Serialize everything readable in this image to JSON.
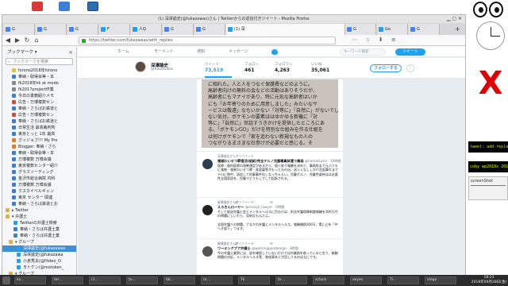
{
  "browser": {
    "window_title": "(1) 深澤諭史(@fukazawas)さん | Twitterからの返信付きツイート - Mozilla Firefox",
    "url": "https://twitter.com/fukazawas/with_replies",
    "tabs": [
      "G",
      "G",
      "G",
      "F",
      "人Q",
      "G",
      "G",
      "(1) 深",
      "G",
      "Go",
      "G"
    ],
    "tab_active_index": 7,
    "nav_buttons": [
      "◀",
      "▶",
      "↻",
      "⌂"
    ],
    "tool_icons": "⋯ ☆ ⬇ ≡"
  },
  "sidebar": {
    "title": "ブックマーク ▾",
    "close": "×",
    "search_placeholder": "ブックマークを検索",
    "items": [
      {
        "label": "hirono2018年hirono",
        "color": "#e8c23a",
        "indent": 12,
        "selected": false
      },
      {
        "label": "奉納・取得会等・本",
        "color": "#3a7ed6",
        "indent": 12,
        "selected": false
      },
      {
        "label": "fk2018年hk at modo",
        "color": "#888888",
        "indent": 12,
        "selected": false
      },
      {
        "label": "fk2017project作業",
        "color": "#888888",
        "indent": 12,
        "selected": false
      },
      {
        "label": "今日の書籍紹介メモ",
        "color": "#3a7ed6",
        "indent": 12,
        "selected": false
      },
      {
        "label": "広告・万博複数セン",
        "color": "#d64a3a",
        "indent": 12,
        "selected": false
      },
      {
        "label": "奉納・さらばお鉄道と",
        "color": "#3a7ed6",
        "indent": 12,
        "selected": false
      },
      {
        "label": "広告・万博複数セン",
        "color": "#d64a3a",
        "indent": 12,
        "selected": false
      },
      {
        "label": "奉納・さらばお鉄道と",
        "color": "#3a7ed6",
        "indent": 12,
        "selected": false
      },
      {
        "label": "日常生活 最高裁判所",
        "color": "#3a7ed6",
        "indent": 12,
        "selected": false
      },
      {
        "label": "東京とっと 1年 最高",
        "color": "#3a7ed6",
        "indent": 12,
        "selected": false
      },
      {
        "label": "グッジョブ!!! My Pro",
        "color": "#e87d1e",
        "indent": 12,
        "selected": false
      },
      {
        "label": "Blogger: 奉納・さら",
        "color": "#e87d1e",
        "indent": 12,
        "selected": false
      },
      {
        "label": "奉納・取得会等・本",
        "color": "#3a7ed6",
        "indent": 12,
        "selected": false
      },
      {
        "label": "万博複数 万博会議",
        "color": "#3a7ed6",
        "indent": 12,
        "selected": false
      },
      {
        "label": "東京複数センター紹介",
        "color": "#3a7ed6",
        "indent": 12,
        "selected": false
      },
      {
        "label": "グラスソーディング",
        "color": "#3a7ed6",
        "indent": 12,
        "selected": false
      },
      {
        "label": "金沢市総合病院 内科",
        "color": "#3a7ed6",
        "indent": 12,
        "selected": false
      },
      {
        "label": "万博複数 万博会議",
        "color": "#3a7ed6",
        "indent": 12,
        "selected": false
      },
      {
        "label": "クスカイベルギャン",
        "color": "#3a7ed6",
        "indent": 12,
        "selected": false
      },
      {
        "label": "東京 センター 関連",
        "color": "#3a7ed6",
        "indent": 12,
        "selected": false
      },
      {
        "label": "奉納・さらば鉄道とお",
        "color": "#3a7ed6",
        "indent": 12,
        "selected": false
      },
      {
        "label": "▸ Twitter",
        "color": "#e0b040",
        "indent": 4,
        "selected": false
      },
      {
        "label": "▾ 弁護士",
        "color": "#e0b040",
        "indent": 4,
        "selected": false
      },
      {
        "label": "Twitterの弁護士検索",
        "color": "#1da1f2",
        "indent": 14,
        "selected": false
      },
      {
        "label": "奉納・さらば弁護士業",
        "color": "#3a7ed6",
        "indent": 14,
        "selected": false
      },
      {
        "label": "奉納・さらば弁護士業",
        "color": "#3a7ed6",
        "indent": 14,
        "selected": false
      },
      {
        "label": "▾ グループ",
        "color": "#e0b040",
        "indent": 8,
        "selected": false
      },
      {
        "label": "深澤諭史(@fukazawas",
        "color": "#1da1f2",
        "indent": 18,
        "selected": true
      },
      {
        "label": "深澤諭史(@fukazawa",
        "color": "#1da1f2",
        "indent": 18,
        "selected": false
      },
      {
        "label": "小倉秀夫(@Hideo_O",
        "color": "#1da1f2",
        "indent": 18,
        "selected": false
      },
      {
        "label": "モトケン(@motoken_",
        "color": "#1da1f2",
        "indent": 18,
        "selected": false
      },
      {
        "label": "▾ グループ",
        "color": "#e0b040",
        "indent": 8,
        "selected": false
      },
      {
        "label": "奉納・新聞・裁判・",
        "color": "#3a7ed6",
        "indent": 18,
        "selected": false
      }
    ]
  },
  "twitter": {
    "nav": [
      "ホーム",
      "モーメント",
      "通知",
      "メッセージ"
    ],
    "search_placeholder": "キーワード検索",
    "tweet_button": "ツイート",
    "profile": {
      "name": "深澤諭史",
      "handle": "@fukazawas",
      "stats": [
        {
          "label": "ツイート",
          "value": "73,519",
          "active": true
        },
        {
          "label": "フォロー",
          "value": "461",
          "active": false
        },
        {
          "label": "フォロワー",
          "value": "4,263",
          "active": false
        },
        {
          "label": "いいね",
          "value": "35,061",
          "active": false
        }
      ],
      "follow_button": "フォローする",
      "more_button": "⋮"
    },
    "photo_text": [
      "に相れた。人と人をつなぐ保護費などのように。",
      "高齢者向けの無料の会などの活動はありそうだが、",
      "高齢者にもマナイがあり、特に元気な高齢者はいか",
      "にも「お年寄りのために用意しました」みたいなサ",
      "ービスは敬遠」なもいかない「対等に」「自然に」がないでし",
      "ない気付。ボケモンの要素ははゆかゆる新機に「対",
      "等に」「自然に」世話すうきかけを提供したところにあ",
      "る。「ボケモンGO」だけを特別な仕組みを作る仕組を",
      "は何けボケモンで「家を追わない新規なもの人の",
      "つながりるまさまな社参けが必要だと感じる。そ"
    ],
    "tweets": [
      {
        "retweet_by": "深澤諭史さんがリツイート",
        "author": "複雑わいせつ罪復活(紹紹)完全テルノ児童職員試運ラ業画",
        "meta": "@hamasiyosi · 16時間",
        "body": "医師・歯科医師の過剰規定があるから、個人依り報酬を決めて、事務所まで元ぶうもに強制・強制わいせつ罪・准容疑等がもっと分の出、送らくなししかけ否起算れまでテロに問中、訴訟して刑事事件化しなっちゃえい。児童ポルノ、児童性虐待はは必要性全国容認を、児童マどうもしでして起訴される。",
        "avatar_color": "#2c3e50"
      },
      {
        "retweet_by": "深澤諭史さんがリツイート",
        "author": "えろきんローヤー",
        "meta": "@erosyo_lawyer · 9時間",
        "body": "そして放送弁護士会とメンタルヘルスに目仕けば、刑法弁護保障制度報酬を300万円の問題にしいたら、深刻なもんだよ。\n\n全国弁護人の問題、ナなかわ弁護とメンタルヘルス、報酬補償300万、実に心を「中へす部下」つます。",
        "avatar_color": "#222222"
      },
      {
        "retweet_by": "深澤諭史さんがリツイート",
        "author": "ワーキングプア弁護士",
        "meta": "@workingpoorbengo · 3時間",
        "body": "今の弁護士業界には、逃を確保していないだけでは何業務を取っていると言う、報酬問題の対応、メンタルヘルス等、育成資本くが回しうるのはなにです。",
        "avatar_color": "#555555"
      }
    ],
    "tweet_actions": [
      "↩",
      "⇄ ",
      "♡ ",
      "✉"
    ]
  },
  "desktop": {
    "side_window_1": "tweet: add-replay-unq-il",
    "side_window_2": "coby wp2018x 2018-0",
    "side_window_3": "screenShot",
    "x_mark": "X"
  },
  "taskbar": {
    "tasks": [
      "ko...",
      "ter...",
      "(1...",
      "te...",
      "bb...",
      "m...",
      "Tk",
      "te...",
      "xclock",
      "xeyes",
      "Ti...",
      "xlogo"
    ],
    "time": "18:23",
    "date": "2018年09月28日(金)"
  }
}
